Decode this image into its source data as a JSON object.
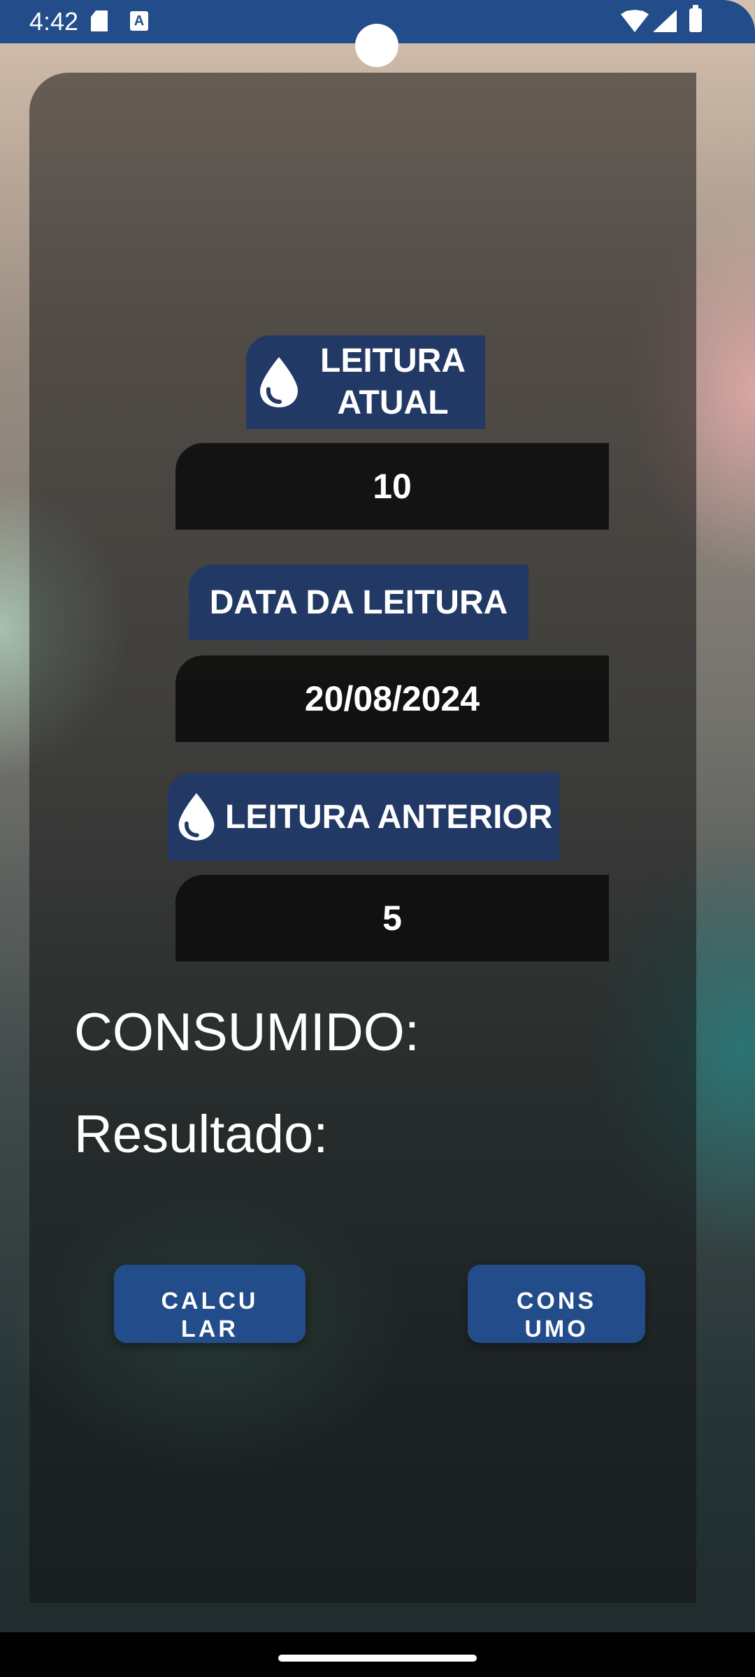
{
  "status_bar": {
    "time": "4:42",
    "icons": [
      "sd-card-icon",
      "text-a-icon",
      "wifi-icon",
      "signal-icon",
      "battery-icon"
    ],
    "color": "#224c8a"
  },
  "form": {
    "current_reading": {
      "label": "LEITURA ATUAL",
      "value": "10",
      "icon": "water-drop-icon"
    },
    "reading_date": {
      "label": "DATA DA LEITURA",
      "value": "20/08/2024"
    },
    "previous_reading": {
      "label": "LEITURA ANTERIOR",
      "value": "5",
      "icon": "water-drop-icon"
    }
  },
  "results": {
    "consumed_label": "CONSUMIDO:",
    "result_label": "Resultado:"
  },
  "buttons": {
    "calculate": "CALCULAR",
    "consumption": "CONSUMO"
  },
  "colors": {
    "accent": "#224c8a",
    "label_bg": "#223966"
  }
}
